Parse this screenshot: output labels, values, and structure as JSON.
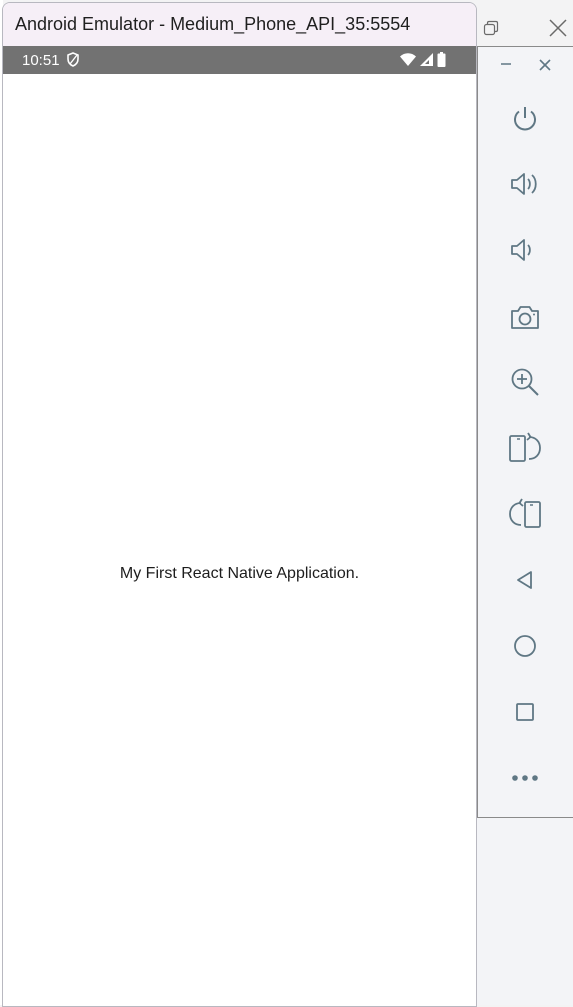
{
  "window": {
    "title": "Android Emulator - Medium_Phone_API_35:5554"
  },
  "status_bar": {
    "time": "10:51"
  },
  "app": {
    "text": "My First React Native Application."
  },
  "side_panel": {
    "buttons": [
      {
        "name": "power-icon"
      },
      {
        "name": "volume-up-icon"
      },
      {
        "name": "volume-down-icon"
      },
      {
        "name": "camera-icon"
      },
      {
        "name": "zoom-icon"
      },
      {
        "name": "rotate-left-icon"
      },
      {
        "name": "rotate-right-icon"
      },
      {
        "name": "back-icon"
      },
      {
        "name": "home-icon"
      },
      {
        "name": "overview-icon"
      },
      {
        "name": "more-icon"
      }
    ]
  },
  "colors": {
    "status_bar": "#727272",
    "titlebar": "#f6eff7",
    "panel": "#f3f4f7",
    "icon": "#5f7784"
  }
}
